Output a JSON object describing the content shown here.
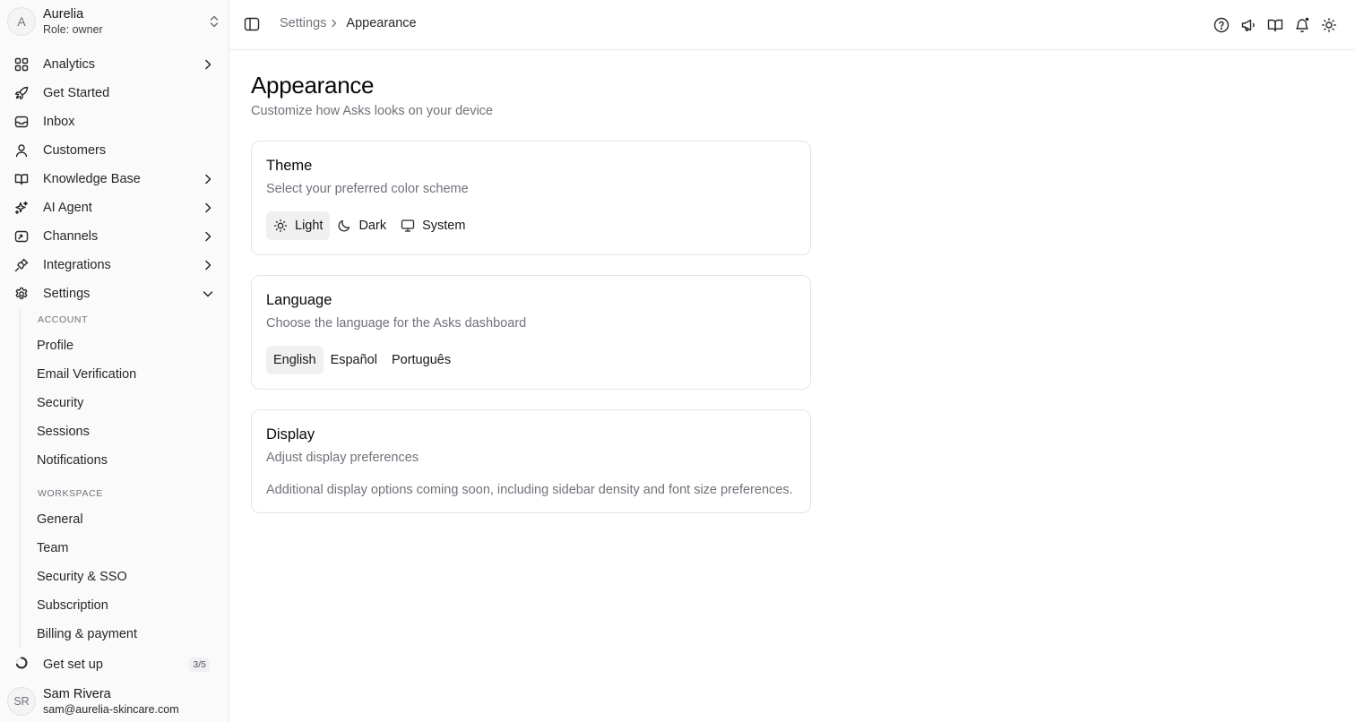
{
  "workspace": {
    "initial": "A",
    "name": "Aurelia",
    "role": "Role: owner"
  },
  "nav": [
    {
      "label": "Analytics",
      "icon": "grid-icon",
      "chevron": "right"
    },
    {
      "label": "Get Started",
      "icon": "rocket-icon",
      "chevron": ""
    },
    {
      "label": "Inbox",
      "icon": "inbox-icon",
      "chevron": ""
    },
    {
      "label": "Customers",
      "icon": "user-icon",
      "chevron": ""
    },
    {
      "label": "Knowledge Base",
      "icon": "book-icon",
      "chevron": "right"
    },
    {
      "label": "AI Agent",
      "icon": "sparkles-icon",
      "chevron": "right"
    },
    {
      "label": "Channels",
      "icon": "share-icon",
      "chevron": "right"
    },
    {
      "label": "Integrations",
      "icon": "plug-icon",
      "chevron": "right"
    },
    {
      "label": "Settings",
      "icon": "gear-icon",
      "chevron": "down"
    }
  ],
  "settings_menu": {
    "account_heading": "ACCOUNT",
    "account": [
      "Profile",
      "Email Verification",
      "Security",
      "Sessions",
      "Notifications"
    ],
    "workspace_heading": "WORKSPACE",
    "workspace": [
      "General",
      "Team",
      "Security & SSO",
      "Subscription",
      "Billing & payment"
    ]
  },
  "setup": {
    "label": "Get set up",
    "count": "3/5"
  },
  "user": {
    "initials": "SR",
    "name": "Sam Rivera",
    "email": "sam@aurelia-skincare.com"
  },
  "breadcrumb": {
    "parent": "Settings",
    "current": "Appearance"
  },
  "top_icons": [
    "help-circle-icon",
    "megaphone-icon",
    "book-open-icon",
    "bell-icon",
    "sun-icon"
  ],
  "page": {
    "title": "Appearance",
    "subtitle": "Customize how Asks looks on your device"
  },
  "theme_card": {
    "title": "Theme",
    "description": "Select your preferred color scheme",
    "options": [
      {
        "label": "Light",
        "icon": "sun-icon",
        "selected": true
      },
      {
        "label": "Dark",
        "icon": "moon-icon",
        "selected": false
      },
      {
        "label": "System",
        "icon": "monitor-icon",
        "selected": false
      }
    ]
  },
  "language_card": {
    "title": "Language",
    "description": "Choose the language for the Asks dashboard",
    "options": [
      {
        "label": "English",
        "selected": true
      },
      {
        "label": "Español",
        "selected": false
      },
      {
        "label": "Português",
        "selected": false
      }
    ]
  },
  "display_card": {
    "title": "Display",
    "description": "Adjust display preferences",
    "note": "Additional display options coming soon, including sidebar density and font size preferences."
  },
  "colors": {
    "accent": "#18181b",
    "muted": "#71717a",
    "border": "#e4e4e7",
    "selected_bg": "#f0f0f1"
  }
}
